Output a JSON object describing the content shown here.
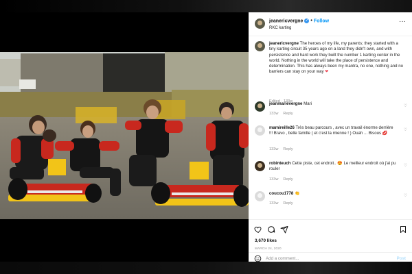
{
  "post": {
    "username": "jeanericvergne",
    "verified_mark": "✓",
    "separator": "•",
    "follow_label": "Follow",
    "location": "RKC karting",
    "more_label": "···",
    "caption_user": "jeanericvergne",
    "caption_body": "The heroes of my life, my parents; they started with a tiny karting circuit 35 years ago on a land they didn't own, and with persistence and hard work they built the number 1 karting center in the world. Nothing in the world will take the place of persistence and determination. This has always been my mantra, no one, nothing and no barriers can stay on your way",
    "caption_heart": "❤",
    "caption_meta": "Edited · 133w",
    "likes": "3,670 likes",
    "date": "MARCH 24, 2020",
    "add_comment_placeholder": "Add a comment...",
    "post_label": "Post"
  },
  "comments": [
    {
      "user": "jeanmarievergne",
      "text": "Mari",
      "age": "133w",
      "reply": "Reply"
    },
    {
      "user": "mamireille26",
      "text": "Très beau parcours , avec un travail énorme derrière !!! Bravo , belle famille ( et c'est la mienne ! ) Ouah ... Bisous 💋",
      "age": "133w",
      "reply": "Reply"
    },
    {
      "user": "robinteuch",
      "text": "Cette piste, cet endroit.. 😍 Le meilleur endroit où j'ai pu rouler",
      "age": "133w",
      "reply": "Reply"
    },
    {
      "user": "coucou1778",
      "text": "👏",
      "age": "133w",
      "reply": "Reply"
    }
  ],
  "icons": {
    "heart": "heart-icon",
    "comment": "comment-icon",
    "share": "share-icon",
    "save": "bookmark-icon",
    "emoji": "emoji-icon",
    "more": "more-options-icon"
  },
  "colors": {
    "follow_blue": "#0095f6",
    "verified_blue": "#3897f0",
    "muted_text": "#8e8e8e",
    "post_disabled": "#b2dffc",
    "kart_yellow": "#f2c418",
    "suit_red": "#c8281e"
  }
}
